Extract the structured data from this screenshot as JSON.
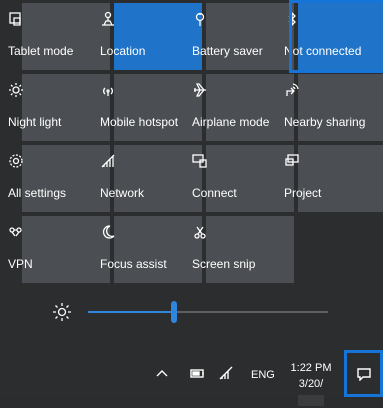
{
  "tiles": [
    {
      "label": "Tablet mode",
      "icon": "tablet-mode-icon",
      "active": false
    },
    {
      "label": "Location",
      "icon": "location-icon",
      "active": true
    },
    {
      "label": "Battery saver",
      "icon": "battery-saver-icon",
      "active": false
    },
    {
      "label": "Not connected",
      "icon": "bluetooth-icon",
      "active": true,
      "highlight": true
    },
    {
      "label": "Night light",
      "icon": "night-light-icon",
      "active": false
    },
    {
      "label": "Mobile hotspot",
      "icon": "mobile-hotspot-icon",
      "active": false
    },
    {
      "label": "Airplane mode",
      "icon": "airplane-mode-icon",
      "active": false
    },
    {
      "label": "Nearby sharing",
      "icon": "nearby-sharing-icon",
      "active": false
    },
    {
      "label": "All settings",
      "icon": "settings-icon",
      "active": false
    },
    {
      "label": "Network",
      "icon": "network-icon",
      "active": false
    },
    {
      "label": "Connect",
      "icon": "connect-icon",
      "active": false
    },
    {
      "label": "Project",
      "icon": "project-icon",
      "active": false
    },
    {
      "label": "VPN",
      "icon": "vpn-icon",
      "active": false
    },
    {
      "label": "Focus assist",
      "icon": "focus-assist-icon",
      "active": false
    },
    {
      "label": "Screen snip",
      "icon": "screen-snip-icon",
      "active": false
    }
  ],
  "brightness": {
    "level_percent": 36
  },
  "taskbar": {
    "language": "ENG",
    "time": "1:22 PM",
    "date": "3/20/"
  },
  "colors": {
    "accent": "#1f73c8",
    "tile": "#4b4e52",
    "highlight": "#1674d8"
  }
}
